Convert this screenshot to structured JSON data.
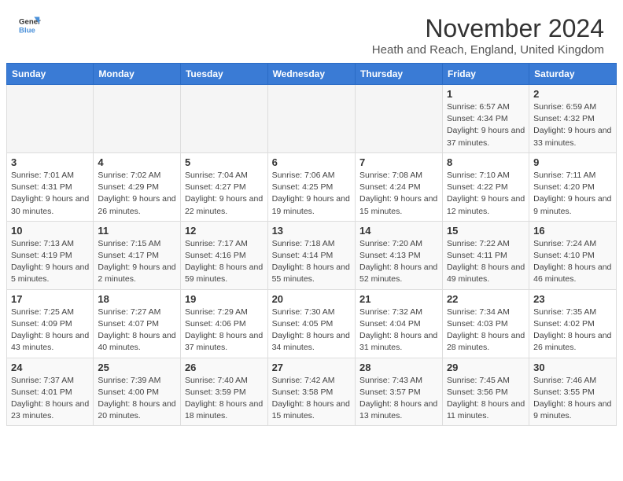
{
  "header": {
    "logo_line1": "General",
    "logo_line2": "Blue",
    "month_title": "November 2024",
    "subtitle": "Heath and Reach, England, United Kingdom"
  },
  "columns": [
    "Sunday",
    "Monday",
    "Tuesday",
    "Wednesday",
    "Thursday",
    "Friday",
    "Saturday"
  ],
  "weeks": [
    [
      {
        "day": "",
        "info": ""
      },
      {
        "day": "",
        "info": ""
      },
      {
        "day": "",
        "info": ""
      },
      {
        "day": "",
        "info": ""
      },
      {
        "day": "",
        "info": ""
      },
      {
        "day": "1",
        "info": "Sunrise: 6:57 AM\nSunset: 4:34 PM\nDaylight: 9 hours and 37 minutes."
      },
      {
        "day": "2",
        "info": "Sunrise: 6:59 AM\nSunset: 4:32 PM\nDaylight: 9 hours and 33 minutes."
      }
    ],
    [
      {
        "day": "3",
        "info": "Sunrise: 7:01 AM\nSunset: 4:31 PM\nDaylight: 9 hours and 30 minutes."
      },
      {
        "day": "4",
        "info": "Sunrise: 7:02 AM\nSunset: 4:29 PM\nDaylight: 9 hours and 26 minutes."
      },
      {
        "day": "5",
        "info": "Sunrise: 7:04 AM\nSunset: 4:27 PM\nDaylight: 9 hours and 22 minutes."
      },
      {
        "day": "6",
        "info": "Sunrise: 7:06 AM\nSunset: 4:25 PM\nDaylight: 9 hours and 19 minutes."
      },
      {
        "day": "7",
        "info": "Sunrise: 7:08 AM\nSunset: 4:24 PM\nDaylight: 9 hours and 15 minutes."
      },
      {
        "day": "8",
        "info": "Sunrise: 7:10 AM\nSunset: 4:22 PM\nDaylight: 9 hours and 12 minutes."
      },
      {
        "day": "9",
        "info": "Sunrise: 7:11 AM\nSunset: 4:20 PM\nDaylight: 9 hours and 9 minutes."
      }
    ],
    [
      {
        "day": "10",
        "info": "Sunrise: 7:13 AM\nSunset: 4:19 PM\nDaylight: 9 hours and 5 minutes."
      },
      {
        "day": "11",
        "info": "Sunrise: 7:15 AM\nSunset: 4:17 PM\nDaylight: 9 hours and 2 minutes."
      },
      {
        "day": "12",
        "info": "Sunrise: 7:17 AM\nSunset: 4:16 PM\nDaylight: 8 hours and 59 minutes."
      },
      {
        "day": "13",
        "info": "Sunrise: 7:18 AM\nSunset: 4:14 PM\nDaylight: 8 hours and 55 minutes."
      },
      {
        "day": "14",
        "info": "Sunrise: 7:20 AM\nSunset: 4:13 PM\nDaylight: 8 hours and 52 minutes."
      },
      {
        "day": "15",
        "info": "Sunrise: 7:22 AM\nSunset: 4:11 PM\nDaylight: 8 hours and 49 minutes."
      },
      {
        "day": "16",
        "info": "Sunrise: 7:24 AM\nSunset: 4:10 PM\nDaylight: 8 hours and 46 minutes."
      }
    ],
    [
      {
        "day": "17",
        "info": "Sunrise: 7:25 AM\nSunset: 4:09 PM\nDaylight: 8 hours and 43 minutes."
      },
      {
        "day": "18",
        "info": "Sunrise: 7:27 AM\nSunset: 4:07 PM\nDaylight: 8 hours and 40 minutes."
      },
      {
        "day": "19",
        "info": "Sunrise: 7:29 AM\nSunset: 4:06 PM\nDaylight: 8 hours and 37 minutes."
      },
      {
        "day": "20",
        "info": "Sunrise: 7:30 AM\nSunset: 4:05 PM\nDaylight: 8 hours and 34 minutes."
      },
      {
        "day": "21",
        "info": "Sunrise: 7:32 AM\nSunset: 4:04 PM\nDaylight: 8 hours and 31 minutes."
      },
      {
        "day": "22",
        "info": "Sunrise: 7:34 AM\nSunset: 4:03 PM\nDaylight: 8 hours and 28 minutes."
      },
      {
        "day": "23",
        "info": "Sunrise: 7:35 AM\nSunset: 4:02 PM\nDaylight: 8 hours and 26 minutes."
      }
    ],
    [
      {
        "day": "24",
        "info": "Sunrise: 7:37 AM\nSunset: 4:01 PM\nDaylight: 8 hours and 23 minutes."
      },
      {
        "day": "25",
        "info": "Sunrise: 7:39 AM\nSunset: 4:00 PM\nDaylight: 8 hours and 20 minutes."
      },
      {
        "day": "26",
        "info": "Sunrise: 7:40 AM\nSunset: 3:59 PM\nDaylight: 8 hours and 18 minutes."
      },
      {
        "day": "27",
        "info": "Sunrise: 7:42 AM\nSunset: 3:58 PM\nDaylight: 8 hours and 15 minutes."
      },
      {
        "day": "28",
        "info": "Sunrise: 7:43 AM\nSunset: 3:57 PM\nDaylight: 8 hours and 13 minutes."
      },
      {
        "day": "29",
        "info": "Sunrise: 7:45 AM\nSunset: 3:56 PM\nDaylight: 8 hours and 11 minutes."
      },
      {
        "day": "30",
        "info": "Sunrise: 7:46 AM\nSunset: 3:55 PM\nDaylight: 8 hours and 9 minutes."
      }
    ]
  ]
}
